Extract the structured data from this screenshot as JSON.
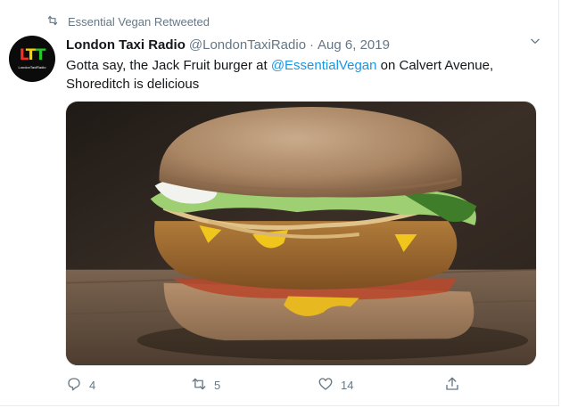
{
  "retweet_context": {
    "label": "Essential Vegan Retweeted"
  },
  "author": {
    "display_name": "London Taxi Radio",
    "handle": "@LondonTaxiRadio",
    "separator": "·",
    "date": "Aug 6, 2019",
    "avatar_letters": [
      "L",
      "T",
      "T"
    ],
    "avatar_caption": "LondonTaxiRadio"
  },
  "tweet": {
    "text_before": "Gotta say, the Jack Fruit burger at ",
    "mention": "@EssentialVegan",
    "text_after": " on Calvert Avenue, Shoreditch is delicious"
  },
  "actions": {
    "reply_count": "4",
    "retweet_count": "5",
    "like_count": "14"
  },
  "colors": {
    "accent": "#1b95e0",
    "muted": "#657786",
    "text": "#14171a"
  },
  "icons": {
    "retweet_context": "retweet-icon",
    "menu": "chevron-down-icon",
    "reply": "reply-icon",
    "retweet": "retweet-icon",
    "like": "heart-icon",
    "share": "share-icon"
  }
}
